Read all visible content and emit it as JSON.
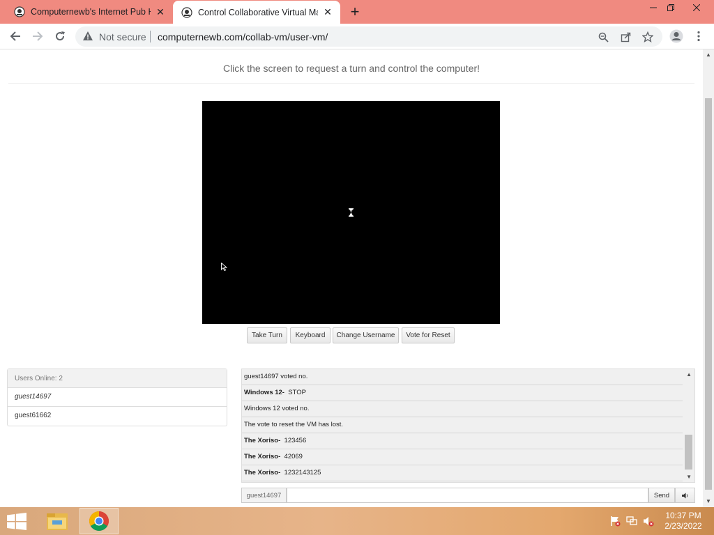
{
  "browser": {
    "tabs": [
      {
        "title": "Computernewb's Internet Pub Hu",
        "active": false
      },
      {
        "title": "Control Collaborative Virtual Ma",
        "active": true
      }
    ],
    "address": {
      "security_label": "Not secure",
      "url": "computernewb.com/collab-vm/user-vm/"
    }
  },
  "page": {
    "instruction": "Click the screen to request a turn and control the computer!",
    "vm_buttons": [
      "Take Turn",
      "Keyboard",
      "Change Username",
      "Vote for Reset"
    ],
    "users": {
      "header": "Users Online: 2",
      "list": [
        "guest14697",
        "guest61662"
      ]
    },
    "chat": {
      "messages": [
        {
          "user": "",
          "text": "guest14697 voted no."
        },
        {
          "user": "Windows 12-",
          "text": "STOP"
        },
        {
          "user": "",
          "text": "Windows 12 voted no."
        },
        {
          "user": "",
          "text": "The vote to reset the VM has lost."
        },
        {
          "user": "The Xoriso-",
          "text": "123456"
        },
        {
          "user": "The Xoriso-",
          "text": "42069"
        },
        {
          "user": "The Xoriso-",
          "text": "1232143125"
        }
      ],
      "username": "guest14697",
      "input_value": "",
      "send_label": "Send"
    }
  },
  "taskbar": {
    "time": "10:37 PM",
    "date": "2/23/2022"
  },
  "colors": {
    "tabstrip": "#f08a80",
    "vm_screen": "#000000",
    "taskbar": "#e7b489"
  }
}
